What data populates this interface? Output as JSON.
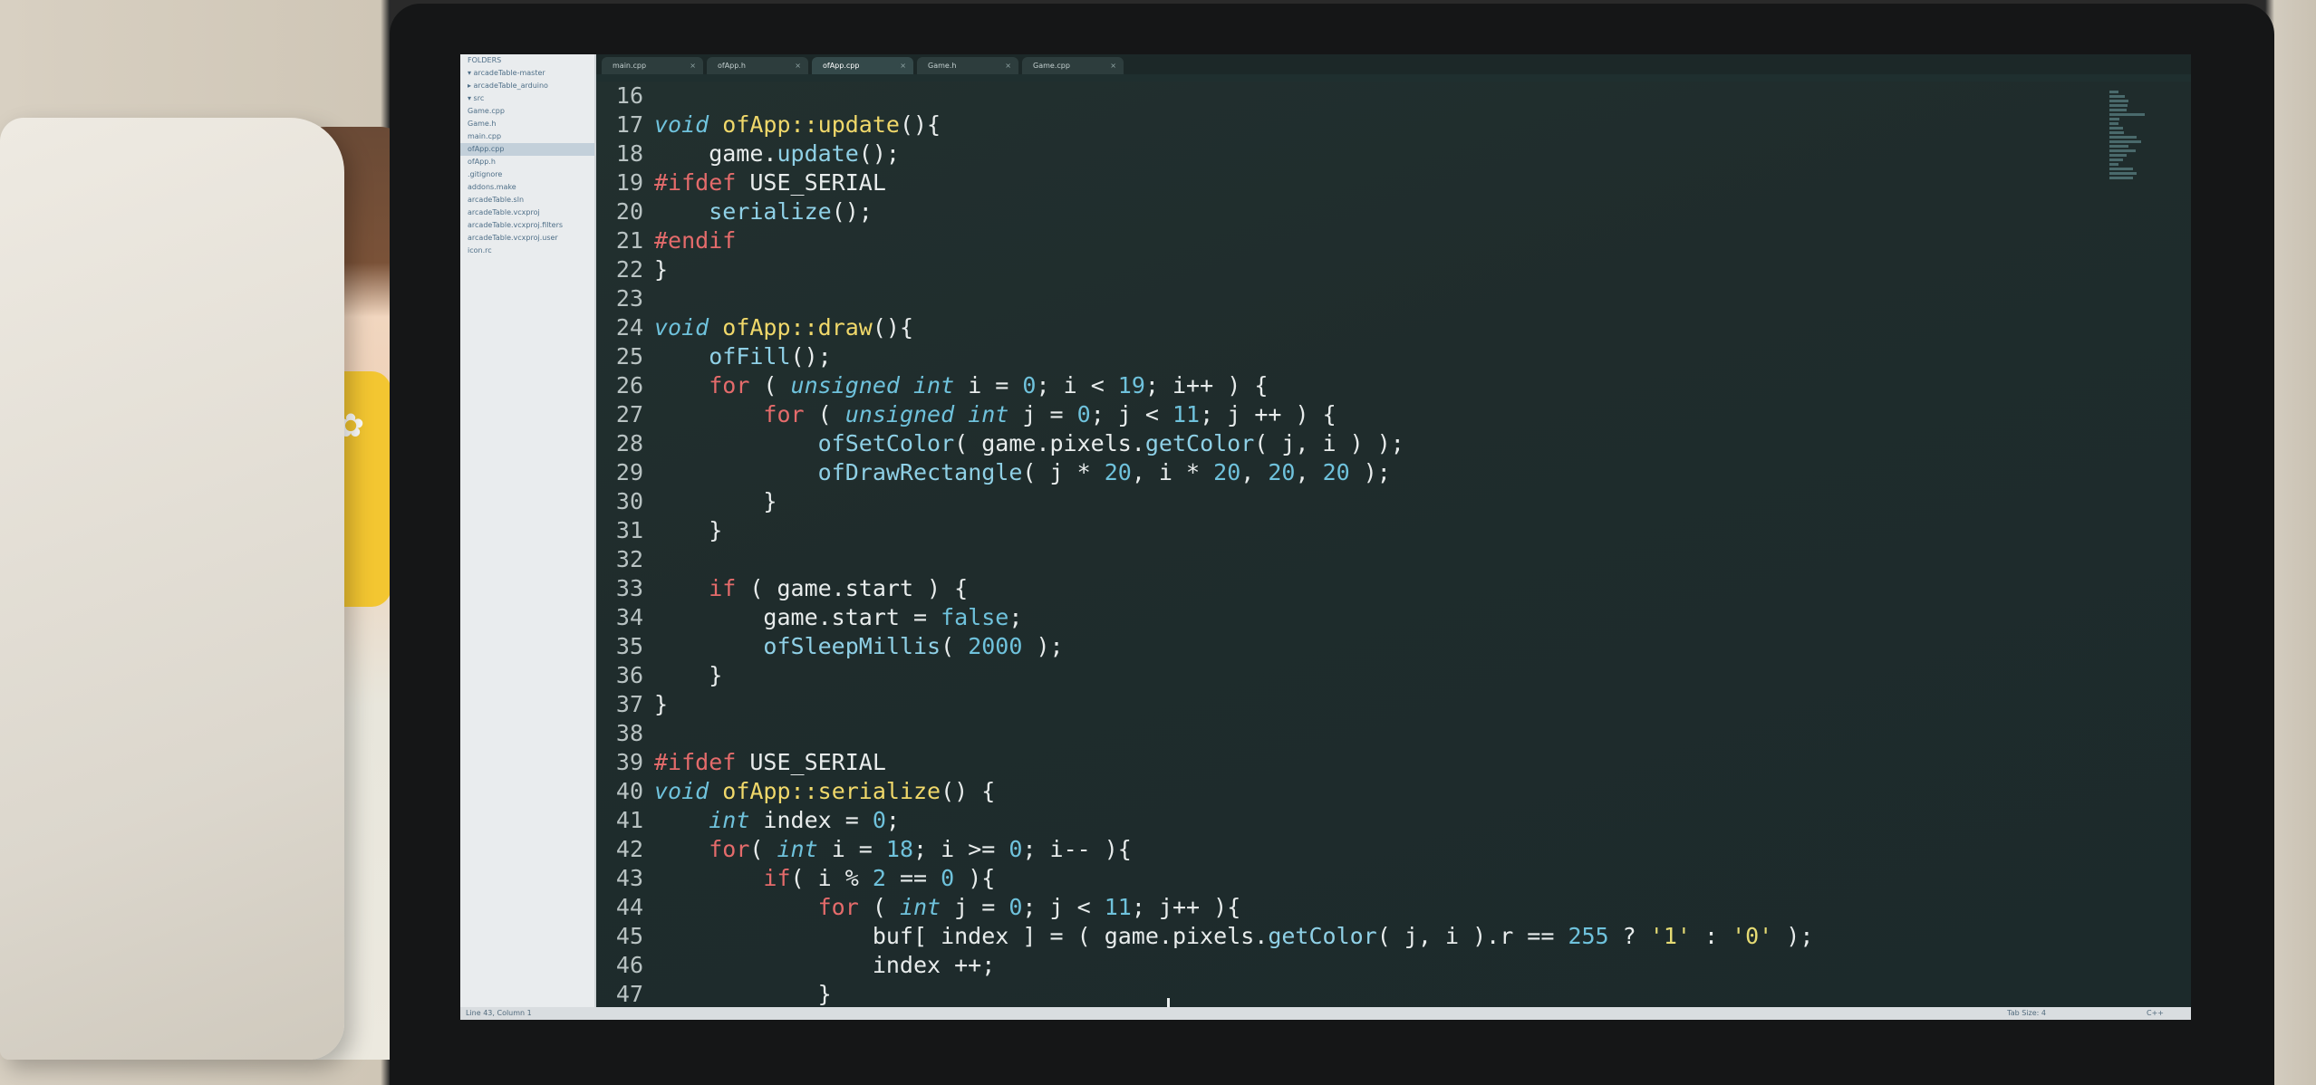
{
  "sidebar": {
    "items": [
      "FOLDERS",
      "▾ arcadeTable-master",
      "  ▸ arcadeTable_arduino",
      "  ▾ src",
      "      Game.cpp",
      "      Game.h",
      "      main.cpp",
      "      ofApp.cpp",
      "      ofApp.h",
      "    .gitignore",
      "    addons.make",
      "    arcadeTable.sln",
      "    arcadeTable.vcxproj",
      "    arcadeTable.vcxproj.filters",
      "    arcadeTable.vcxproj.user",
      "    icon.rc"
    ],
    "active_index": 7
  },
  "tabs": [
    {
      "label": "main.cpp"
    },
    {
      "label": "ofApp.h"
    },
    {
      "label": "ofApp.cpp",
      "active": true
    },
    {
      "label": "Game.h"
    },
    {
      "label": "Game.cpp"
    }
  ],
  "code_lines": [
    {
      "n": "16",
      "html": ""
    },
    {
      "n": "17",
      "html": "<span class='k'>void</span> <span class='f'>ofApp::update</span>(){"
    },
    {
      "n": "18",
      "html": "    game.<span class='b'>update</span>();"
    },
    {
      "n": "19",
      "html": "<span class='p'>#ifdef</span> USE_SERIAL"
    },
    {
      "n": "20",
      "html": "    <span class='b'>serialize</span>();"
    },
    {
      "n": "21",
      "html": "<span class='p'>#endif</span>"
    },
    {
      "n": "22",
      "html": "}"
    },
    {
      "n": "23",
      "html": ""
    },
    {
      "n": "24",
      "html": "<span class='k'>void</span> <span class='f'>ofApp::draw</span>(){"
    },
    {
      "n": "25",
      "html": "    <span class='b'>ofFill</span>();"
    },
    {
      "n": "26",
      "html": "    <span class='p'>for</span> ( <span class='k'>unsigned int</span> i = <span class='n'>0</span>; i &lt; <span class='n'>19</span>; i++ ) {"
    },
    {
      "n": "27",
      "html": "        <span class='p'>for</span> ( <span class='k'>unsigned int</span> j = <span class='n'>0</span>; j &lt; <span class='n'>11</span>; j ++ ) {"
    },
    {
      "n": "28",
      "html": "            <span class='b'>ofSetColor</span>( game.pixels.<span class='b'>getColor</span>( j, i ) );"
    },
    {
      "n": "29",
      "html": "            <span class='b'>ofDrawRectangle</span>( j * <span class='n'>20</span>, i * <span class='n'>20</span>, <span class='n'>20</span>, <span class='n'>20</span> );"
    },
    {
      "n": "30",
      "html": "        }"
    },
    {
      "n": "31",
      "html": "    }"
    },
    {
      "n": "32",
      "html": ""
    },
    {
      "n": "33",
      "html": "    <span class='p'>if</span> ( game.start ) {"
    },
    {
      "n": "34",
      "html": "        game.start = <span class='n'>false</span>;"
    },
    {
      "n": "35",
      "html": "        <span class='b'>ofSleepMillis</span>( <span class='n'>2000</span> );"
    },
    {
      "n": "36",
      "html": "    }"
    },
    {
      "n": "37",
      "html": "}"
    },
    {
      "n": "38",
      "html": ""
    },
    {
      "n": "39",
      "html": "<span class='p'>#ifdef</span> USE_SERIAL"
    },
    {
      "n": "40",
      "html": "<span class='k'>void</span> <span class='f'>ofApp::serialize</span>() {"
    },
    {
      "n": "41",
      "html": "    <span class='k'>int</span> index = <span class='n'>0</span>;"
    },
    {
      "n": "42",
      "html": "    <span class='p'>for</span>( <span class='k'>int</span> i = <span class='n'>18</span>; i &gt;= <span class='n'>0</span>; i-- ){"
    },
    {
      "n": "43",
      "html": "        <span class='p'>if</span>( i % <span class='n'>2</span> == <span class='n'>0</span> ){"
    },
    {
      "n": "44",
      "html": "            <span class='p'>for</span> ( <span class='k'>int</span> j = <span class='n'>0</span>; j &lt; <span class='n'>11</span>; j++ ){"
    },
    {
      "n": "45",
      "html": "                buf[ index ] = ( game.pixels.<span class='b'>getColor</span>( j, i ).r == <span class='n'>255</span> ? <span class='s'>'1'</span> : <span class='s'>'0'</span> );"
    },
    {
      "n": "46",
      "html": "                index ++;"
    },
    {
      "n": "47",
      "html": "            }"
    }
  ],
  "statusbar": {
    "position": "Line 43, Column 1",
    "tab_size": "Tab Size: 4",
    "syntax": "C++"
  },
  "colors": {
    "editor_bg": "#1f2c2c",
    "keyword": "#6fc2dc",
    "function": "#f0d86a",
    "preprocessor": "#e46b6b",
    "string": "#e6db74"
  }
}
